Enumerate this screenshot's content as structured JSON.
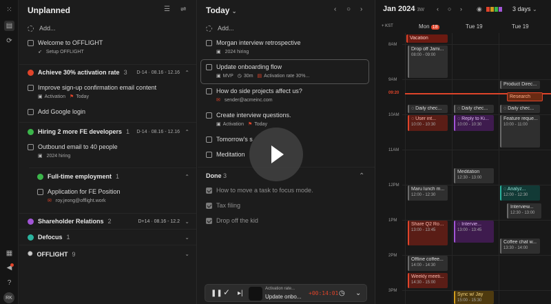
{
  "rail": {
    "avatar": "RK"
  },
  "unplanned": {
    "title": "Unplanned",
    "add_label": "Add...",
    "welcome": {
      "title": "Welcome to OFFLIGHT",
      "sub": "Setup OFFLIGHT"
    },
    "goals": [
      {
        "name": "Achieve 30% activation rate",
        "count": "3",
        "date": "D-14 · 08.16 - 12.16",
        "color": "#e0442a"
      },
      {
        "name": "Hiring 2 more FE developers",
        "count": "1",
        "date": "D-14 · 08.16 - 12.16",
        "color": "#3bb54a"
      },
      {
        "name": "Full-time employment",
        "count": "1",
        "date": "",
        "color": "#3bb54a"
      },
      {
        "name": "Shareholder Relations",
        "count": "2",
        "date": "D+14 · 08.16 - 12.2",
        "date_color": "#e0442a",
        "color": "#a155d6"
      },
      {
        "name": "Defocus",
        "count": "1",
        "date": "",
        "color": "#2bb39e"
      },
      {
        "name": "OFFLIGHT",
        "count": "9",
        "date": "",
        "color": "#cccccc"
      }
    ],
    "tasks": [
      {
        "title": "Improve sign-up confirmation email content",
        "tag": "Activation",
        "due": "Today"
      },
      {
        "title": "Add Google login",
        "tag": "",
        "due": ""
      },
      {
        "title": "Outbound email to 40 people",
        "tag": "2024 hiring",
        "due": ""
      },
      {
        "title": "Application for FE Position",
        "tag": "roy.jeong@offlight.work",
        "due": ""
      }
    ]
  },
  "today": {
    "title": "Today",
    "add_label": "Add...",
    "tasks": [
      {
        "title": "Morgan interview retrospective",
        "tag": "2024 hiring"
      },
      {
        "title": "Update onboarding flow",
        "tag": "MVP",
        "duration": "30m",
        "goal": "Activation rate 30%..."
      },
      {
        "title": "How do side projects affect us?",
        "tag": "sender@acmeinc.com"
      },
      {
        "title": "Create interview questions.",
        "tag": "Activation",
        "due": "Today"
      },
      {
        "title": "Tomorrow's s",
        "tag": ""
      },
      {
        "title": "Meditation",
        "tag": ""
      }
    ],
    "done_label": "Done",
    "done_count": "3",
    "done": [
      "How to move a task to focus mode.",
      "Tax filing",
      "Drop off the kid"
    ],
    "player": {
      "goal": "Activation rate...",
      "task": "Update onbo...",
      "timer": "+00:14:01"
    }
  },
  "calendar": {
    "title": "Jan 2024",
    "week": "3W",
    "view": "3 days",
    "timezone": "+ KST",
    "columns": [
      {
        "label": "Mon",
        "badge": "18"
      },
      {
        "label": "Tue 19"
      },
      {
        "label": "Tue 19"
      }
    ],
    "hours": [
      "8AM",
      "9AM",
      "10AM",
      "11AM",
      "12PM",
      "1PM",
      "2PM",
      "3PM"
    ],
    "now": "09:20",
    "events": [
      {
        "title": "Vacation",
        "time": ""
      },
      {
        "title": "Drop off Jami...",
        "time": "08:00 - 09:00"
      },
      {
        "title": "Product Direc...",
        "time": ""
      },
      {
        "title": "Research",
        "time": ""
      },
      {
        "title": "Daily chec...",
        "time": ""
      },
      {
        "title": "Daily chec...",
        "time": ""
      },
      {
        "title": "Daily chec...",
        "time": ""
      },
      {
        "title": "User int...",
        "time": "10:00 - 10:30"
      },
      {
        "title": "Reply to Ki...",
        "time": "10:00 - 10:30"
      },
      {
        "title": "Feature reque...",
        "time": "10:00 - 11:00"
      },
      {
        "title": "Meditation",
        "time": "12:30 - 13:00"
      },
      {
        "title": "Maru lunch m...",
        "time": "12:00 - 12:30"
      },
      {
        "title": "Analyz...",
        "time": "12:00 - 12:30"
      },
      {
        "title": "Interview...",
        "time": "12:30 - 13:00"
      },
      {
        "title": "Share Q2 Roa...",
        "time": "13:00 - 13:45"
      },
      {
        "title": "Intervie...",
        "time": "13:00 - 13:45"
      },
      {
        "title": "Coffee chat w...",
        "time": "13:30 - 14:00"
      },
      {
        "title": "Offline coffee...",
        "time": "14:00 - 14:30"
      },
      {
        "title": "Weekly meeti...",
        "time": "14:30 - 15:00"
      },
      {
        "title": "Sync w/ Jay",
        "time": "15:00 - 15:30"
      }
    ],
    "colors": {
      "red": "#e0442a",
      "purple": "#a155d6",
      "teal": "#2bb39e",
      "yellow": "#d19c1d"
    }
  }
}
